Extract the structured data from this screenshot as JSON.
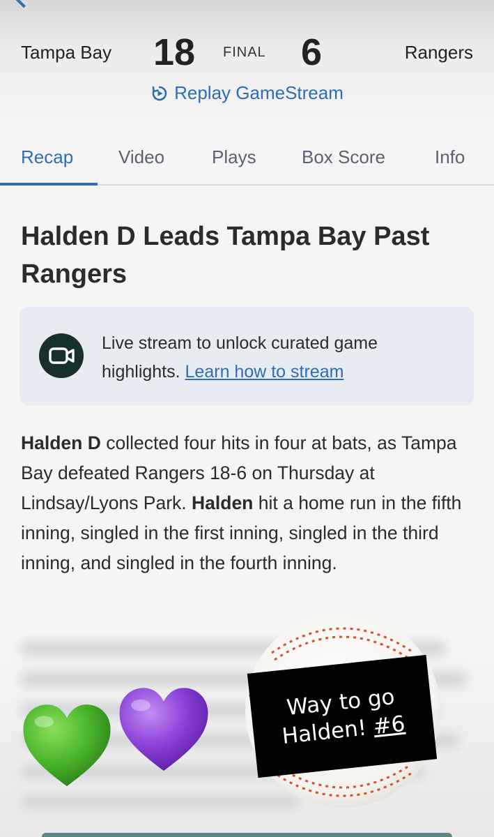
{
  "scoreboard": {
    "home_team": "Tampa Bay",
    "home_score": "18",
    "status": "FINAL",
    "away_score": "6",
    "away_team": "Rangers"
  },
  "replay": {
    "label": "Replay GameStream"
  },
  "tabs": [
    {
      "label": "Recap",
      "active": true
    },
    {
      "label": "Video"
    },
    {
      "label": "Plays"
    },
    {
      "label": "Box Score"
    },
    {
      "label": "Info"
    }
  ],
  "article": {
    "headline": "Halden D Leads Tampa Bay Past Rangers",
    "banner": {
      "text": "Live stream to unlock curated game highlights.",
      "link": "Learn how to stream"
    },
    "paragraph": {
      "lead_name": "Halden D",
      "part1": " collected four hits in four at bats, as Tampa Bay defeated Rangers 18-6 on Thursday at Lindsay/Lyons Park. ",
      "name2": "Halden",
      "part2": " hit a home run in the fifth inning, singled in the first inning, singled in the third inning, and singled in the fourth inning."
    }
  },
  "sticker": {
    "line1": "Way to go",
    "line2": "Halden! ",
    "tag": "#6"
  },
  "colors": {
    "accent": "#2f6db3",
    "green_heart": "#49b52b",
    "purple_heart": "#8a3fd6",
    "stitch": "#d2502a"
  }
}
